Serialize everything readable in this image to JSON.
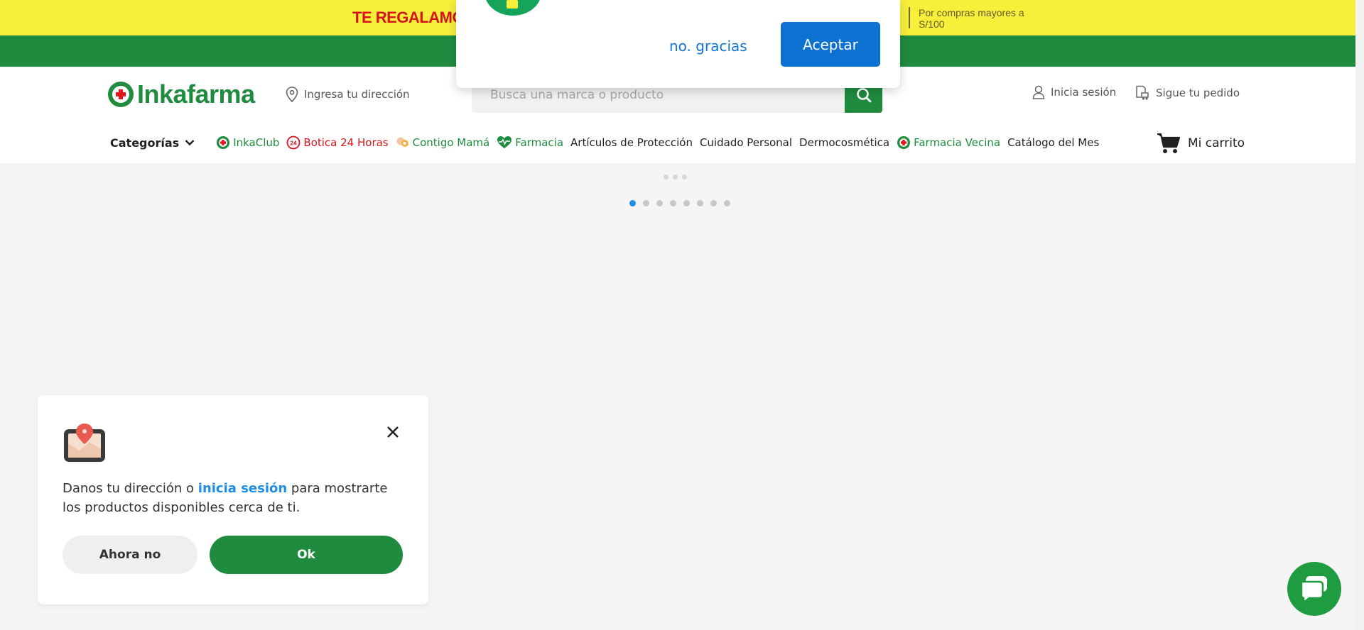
{
  "promo": {
    "headline": "TE REGALAMOS",
    "note": "Por compras mayores a S/100"
  },
  "header": {
    "brand": "Inkafarma",
    "address_label": "Ingresa tu dirección",
    "search_placeholder": "Busca una marca o producto",
    "login_label": "Inicia sesión",
    "track_label": "Sigue tu pedido",
    "cart_label": "Mi carrito"
  },
  "nav": {
    "categories_label": "Categorías",
    "items": [
      {
        "label": "InkaClub",
        "icon": "inkaclub-icon",
        "color": "#1f8b3f"
      },
      {
        "label": "Botica 24 Horas",
        "icon": "24-hours-icon",
        "color": "#d5141c"
      },
      {
        "label": "Contigo Mamá",
        "icon": "mom-icon",
        "color": "#1f8b3f"
      },
      {
        "label": "Farmacia",
        "icon": "heartbeat-icon",
        "color": "#1f8b3f"
      },
      {
        "label": "Artículos de Protección",
        "color": "#222222"
      },
      {
        "label": "Cuidado Personal",
        "color": "#222222"
      },
      {
        "label": "Dermocosmética",
        "color": "#222222"
      },
      {
        "label": "Farmacia Vecina",
        "icon": "inkafarma-cross-icon",
        "color": "#1f8b3f"
      },
      {
        "label": "Catálogo del Mes",
        "color": "#222222"
      }
    ]
  },
  "carousel": {
    "slide_count": 8,
    "active_index": 0
  },
  "notification_prompt": {
    "decline_label": "no. gracias",
    "accept_label": "Aceptar"
  },
  "address_card": {
    "text_before": "Danos tu dirección o ",
    "link_text": "inicia sesión",
    "text_after": " para mostrarte los productos disponibles cerca de ti.",
    "later_label": "Ahora no",
    "ok_label": "Ok"
  },
  "colors": {
    "brand_green": "#1f8b3f",
    "promo_yellow": "#f7ef3a",
    "accent_blue": "#0d71d2",
    "link_blue": "#1f8de6"
  }
}
